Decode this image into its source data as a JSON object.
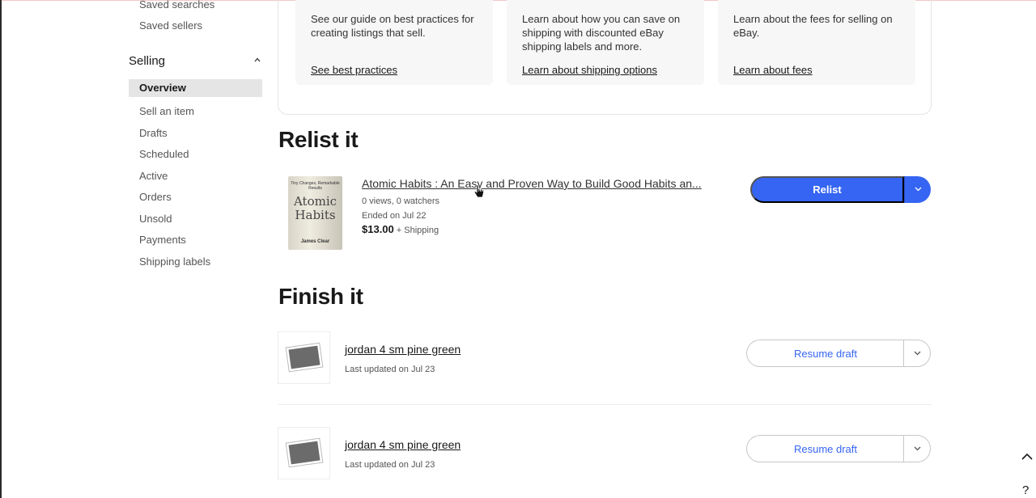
{
  "sidebar": {
    "saved_searches": "Saved searches",
    "saved_sellers": "Saved sellers",
    "selling_heading": "Selling",
    "items": [
      {
        "label": "Overview",
        "active": true
      },
      {
        "label": "Sell an item"
      },
      {
        "label": "Drafts"
      },
      {
        "label": "Scheduled"
      },
      {
        "label": "Active"
      },
      {
        "label": "Orders"
      },
      {
        "label": "Unsold"
      },
      {
        "label": "Payments"
      },
      {
        "label": "Shipping labels"
      }
    ]
  },
  "tips": [
    {
      "text": "See our guide on best practices for creating listings that sell.",
      "link": "See best practices"
    },
    {
      "text": "Learn about how you can save on shipping with discounted eBay shipping labels and more.",
      "link": "Learn about shipping options"
    },
    {
      "text": "Learn about the fees for selling on eBay.",
      "link": "Learn about fees"
    }
  ],
  "relist": {
    "heading": "Relist it",
    "item": {
      "title": "Atomic Habits : An Easy and Proven Way to Build Good Habits an...",
      "stats": "0 views, 0 watchers",
      "ended": "Ended on Jul 22",
      "price": "$13.00",
      "shipping": "+ Shipping",
      "cover_small_top": "Tiny Changes, Remarkable Results",
      "cover_title_1": "Atomic",
      "cover_title_2": "Habits",
      "cover_author": "James Clear"
    },
    "button": "Relist"
  },
  "finish": {
    "heading": "Finish it",
    "drafts": [
      {
        "title": "jordan 4 sm pine green",
        "updated": "Last updated on Jul 23",
        "button": "Resume draft"
      },
      {
        "title": "jordan 4 sm pine green",
        "updated": "Last updated on Jul 23",
        "button": "Resume draft"
      }
    ]
  },
  "icons": {
    "chevron_up": "chevron-up-icon",
    "chevron_down": "chevron-down-icon",
    "photo": "photo-placeholder-icon",
    "help": "?"
  },
  "colors": {
    "accent": "#3665f3",
    "active_bg": "#e5e5e5",
    "tip_bg": "#f7f7f7"
  }
}
